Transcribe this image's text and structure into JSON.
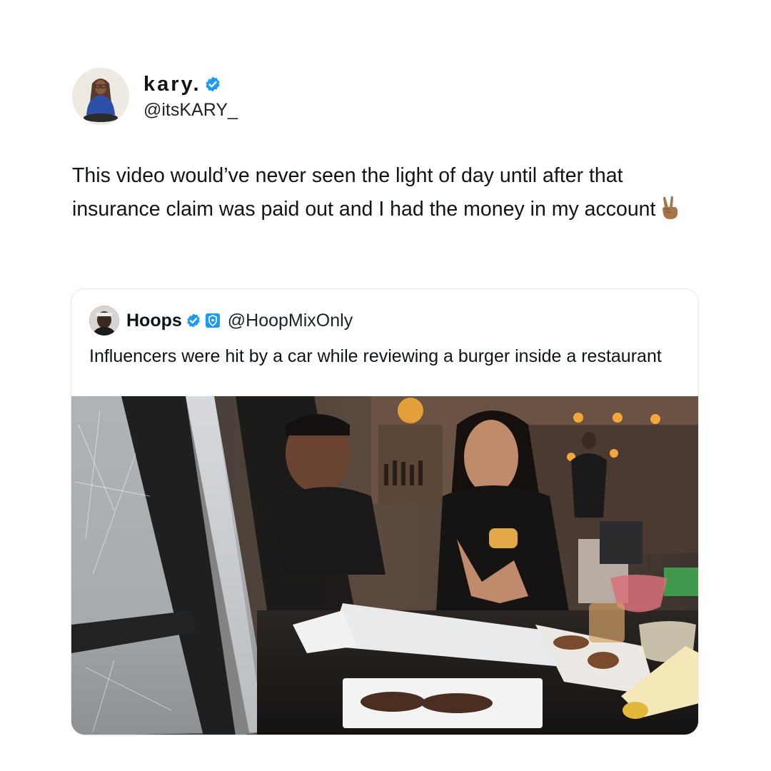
{
  "tweet": {
    "author": {
      "display_name": "kary.",
      "handle": "@itsKARY_",
      "verified": true,
      "avatar": "person-in-blue-sweatshirt"
    },
    "text": "This video would’ve never seen the light of day until after that insurance claim was paid out and I had the money in my account",
    "emoji": "victory-hand-emoji"
  },
  "quote": {
    "author": {
      "display_name": "Hoops",
      "handle": "@HoopMixOnly",
      "verified": true,
      "affiliate_badge": "shield-badge-icon",
      "avatar": "basketball-player"
    },
    "text": "Influencers were hit by a car while reviewing a burger inside a restaurant",
    "media": {
      "kind": "video-frame",
      "description_icon": "restaurant-crash-scene"
    }
  },
  "colors": {
    "verified_blue": "#1d9bf0",
    "text": "#0f1419",
    "border": "#e6e8ea"
  }
}
